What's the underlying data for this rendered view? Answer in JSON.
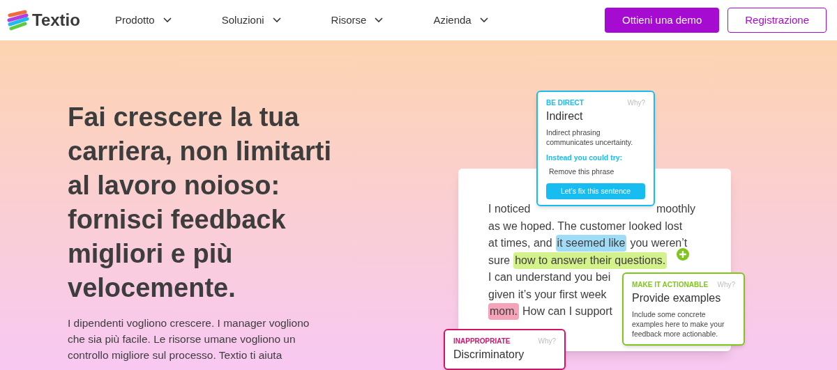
{
  "header": {
    "logo": "Textio",
    "nav": [
      {
        "label": "Prodotto"
      },
      {
        "label": "Soluzioni"
      },
      {
        "label": "Risorse"
      },
      {
        "label": "Azienda"
      }
    ],
    "buttons": [
      {
        "label": "Ottieni una demo",
        "kind": "primary"
      },
      {
        "label": "Registrazione",
        "kind": "outline"
      }
    ]
  },
  "hero": {
    "headline": "Fai crescere la tua carriera, non limitarti al lavoro noioso: fornisci feedback migliori e più velocemente.",
    "paragraph": "I dipendenti vogliono crescere. I manager vogliono che sia più facile. Le risorse umane vogliono un controllo migliore sul processo. Textio ti aiuta"
  },
  "mockup": {
    "lines": [
      {
        "spread": true,
        "segments": [
          {
            "text": "I noticed"
          },
          {
            "text": "moothly"
          }
        ]
      },
      {
        "spread": false,
        "segments": [
          {
            "text": "as we hoped. The customer looked lost"
          }
        ]
      },
      {
        "spread": false,
        "segments": [
          {
            "text": "at times, and"
          },
          {
            "text": "it seemed like",
            "color": "#9fdcf7"
          },
          {
            "text": "you weren’t"
          }
        ]
      },
      {
        "spread": false,
        "segments": [
          {
            "text": "sure"
          },
          {
            "text": "how to answer their questions.",
            "color": "#d4f28c"
          }
        ]
      },
      {
        "spread": false,
        "segments": [
          {
            "text": "I can understand you bei"
          }
        ]
      },
      {
        "spread": false,
        "segments": [
          {
            "text": "given it’s your first week"
          }
        ]
      },
      {
        "spread": false,
        "segments": [
          {
            "text": "mom.",
            "color": "#f4a3b8"
          },
          {
            "text": "How can I support"
          }
        ]
      }
    ],
    "cards": [
      {
        "category": "BE DIRECT",
        "why": "Why?",
        "title": "Indirect",
        "description": "Indirect phrasing communicates uncertainty.",
        "suggestion_label": "Instead you could try:",
        "suggestion": "Remove this phrase",
        "action": "Let’s fix this sentence",
        "color": "#17bdf0"
      },
      {
        "category": "MAKE IT ACTIONABLE",
        "why": "Why?",
        "title": "Provide examples",
        "description": "Include some concrete examples here to make your feedback more actionable.",
        "color": "#7ec51c"
      },
      {
        "category": "INAPPROPRIATE",
        "why": "Why?",
        "title": "Discriminatory",
        "color": "#d3136a"
      }
    ]
  }
}
